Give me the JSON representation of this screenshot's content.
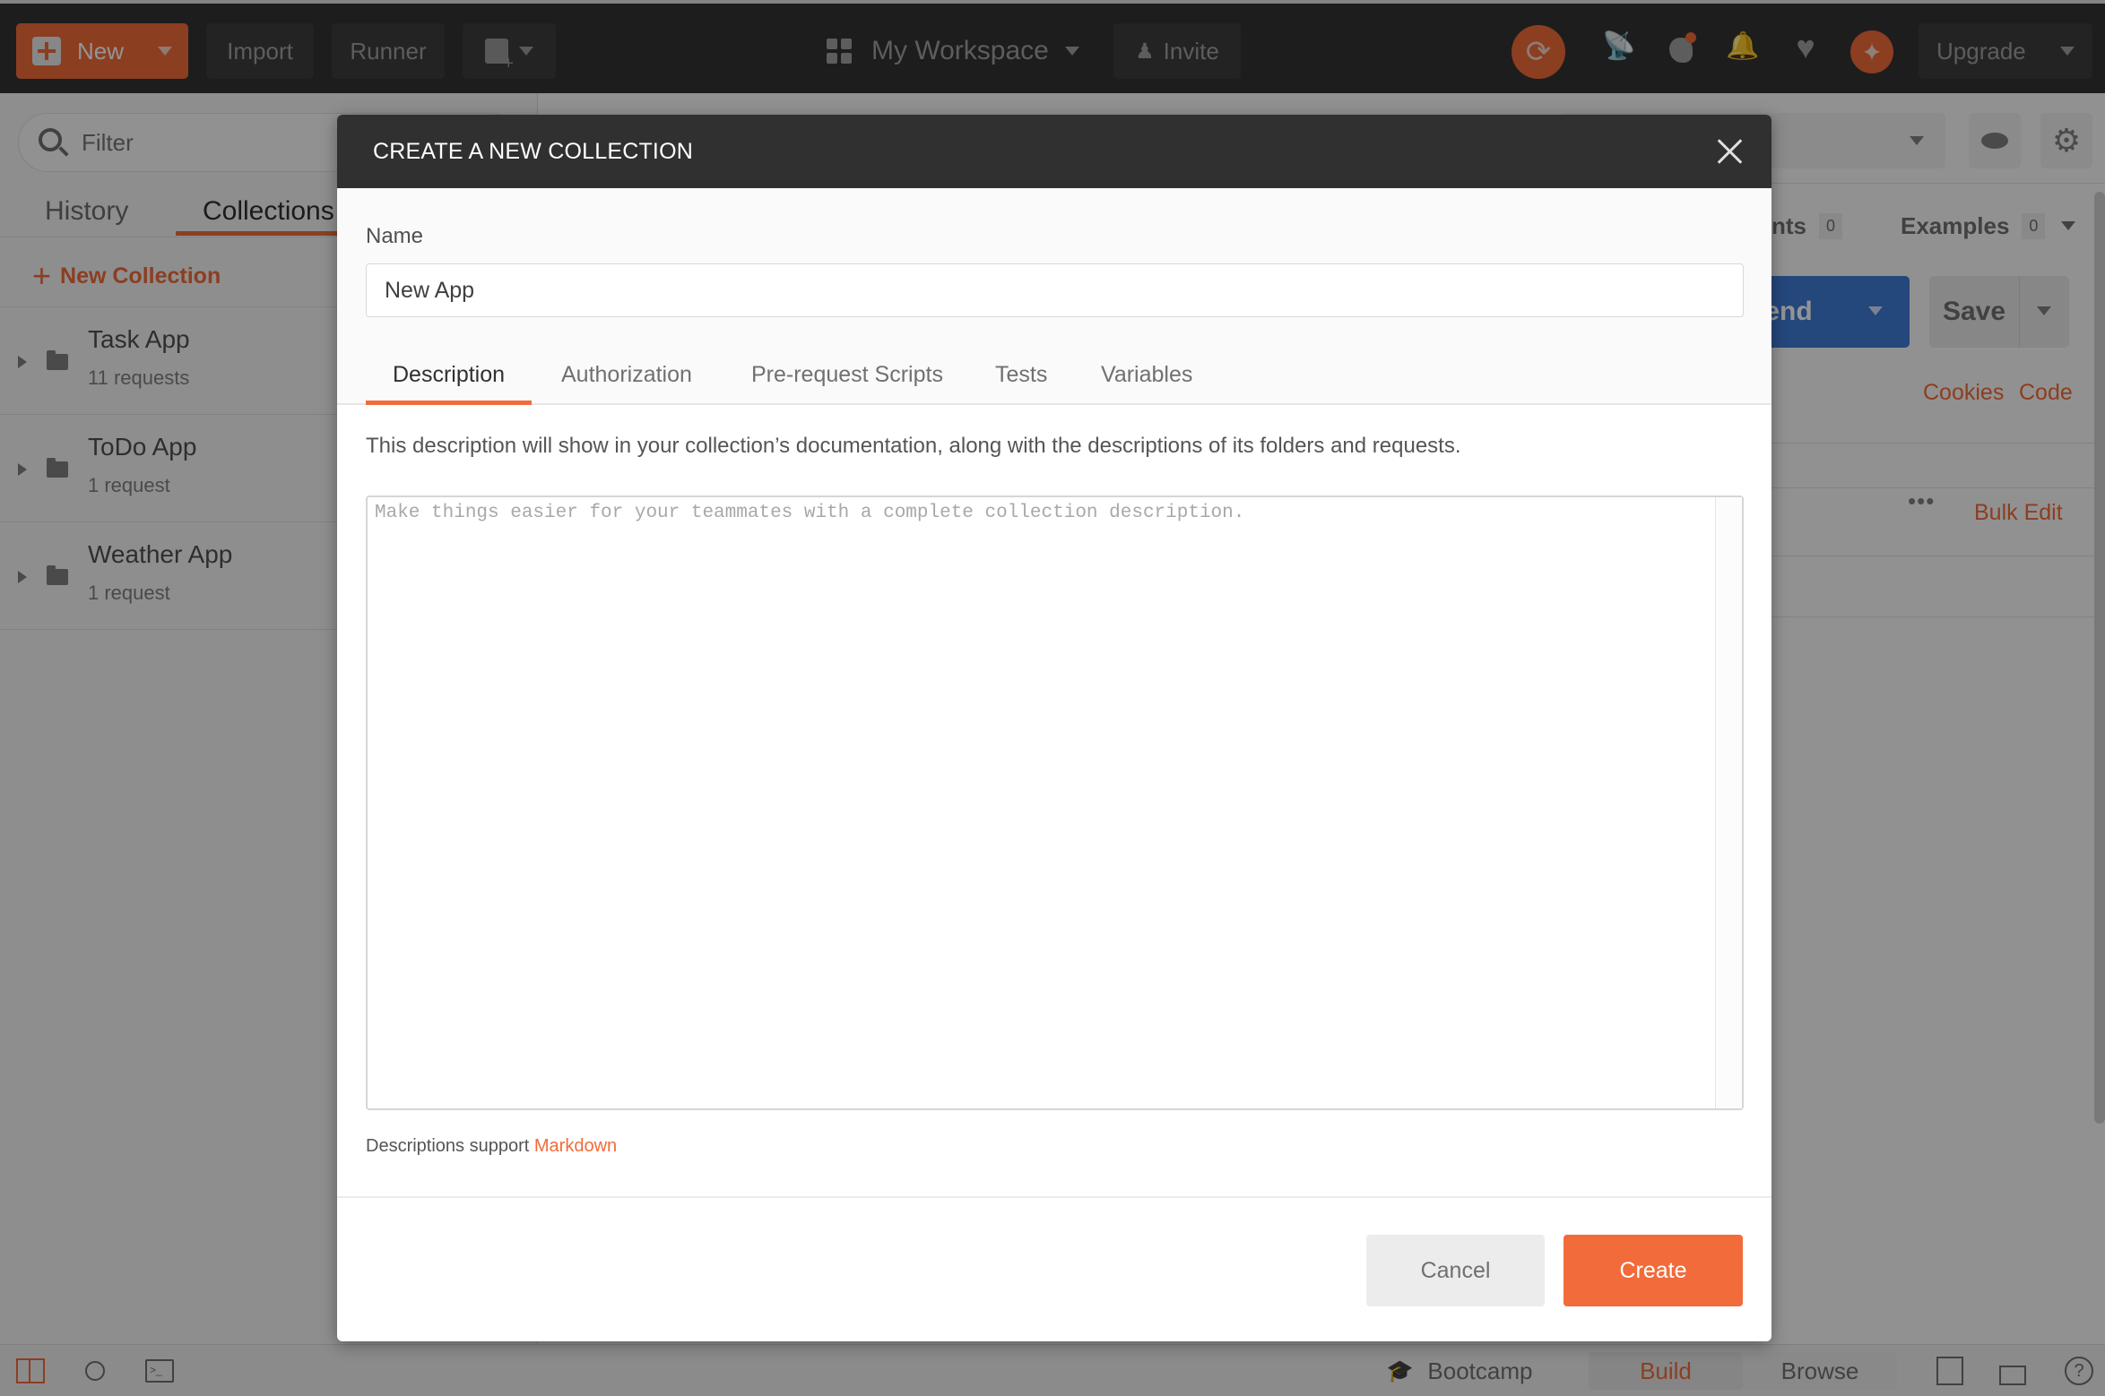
{
  "header": {
    "new_label": "New",
    "import_label": "Import",
    "runner_label": "Runner",
    "workspace_label": "My Workspace",
    "invite_label": "Invite",
    "upgrade_label": "Upgrade",
    "icons": [
      "new-window-icon",
      "workspaces-grid-icon",
      "invite-user-icon",
      "sync-icon",
      "satellite-interceptor-icon",
      "wrench-settings-icon",
      "bell-notifications-icon",
      "heart-icon",
      "sparkle-whats-new-icon"
    ],
    "accent_color": "#f26b3a"
  },
  "sidebar": {
    "filter_placeholder": "Filter",
    "tabs": [
      {
        "label": "History",
        "active": false
      },
      {
        "label": "Collections",
        "active": true
      }
    ],
    "new_collection_label": "New Collection",
    "collections": [
      {
        "name": "Task App",
        "count": "11 requests"
      },
      {
        "name": "ToDo App",
        "count": "1 request"
      },
      {
        "name": "Weather App",
        "count": "1 request"
      }
    ]
  },
  "background": {
    "comments_tab_fragment": "nts",
    "comments_count": "0",
    "examples_label": "Examples",
    "examples_count": "0",
    "send_label": "Send",
    "save_label": "Save",
    "cookies_label": "Cookies",
    "code_label": "Code",
    "bulk_edit_label": "Bulk Edit",
    "send_color": "#3f7bd6"
  },
  "modal": {
    "title": "CREATE A NEW COLLECTION",
    "name_label": "Name",
    "name_value": "New App",
    "tabs": [
      {
        "label": "Description",
        "active": true
      },
      {
        "label": "Authorization",
        "active": false
      },
      {
        "label": "Pre-request Scripts",
        "active": false
      },
      {
        "label": "Tests",
        "active": false
      },
      {
        "label": "Variables",
        "active": false
      }
    ],
    "description_help": "This description will show in your collection’s documentation, along with the descriptions of its folders and requests.",
    "description_placeholder": "Make things easier for your teammates with a complete collection description.",
    "description_value": "",
    "markdown_prefix": "Descriptions support",
    "markdown_link": "Markdown",
    "cancel_label": "Cancel",
    "create_label": "Create"
  },
  "statusbar": {
    "bootcamp_label": "Bootcamp",
    "build_label": "Build",
    "browse_label": "Browse",
    "active_mode": "Build"
  }
}
